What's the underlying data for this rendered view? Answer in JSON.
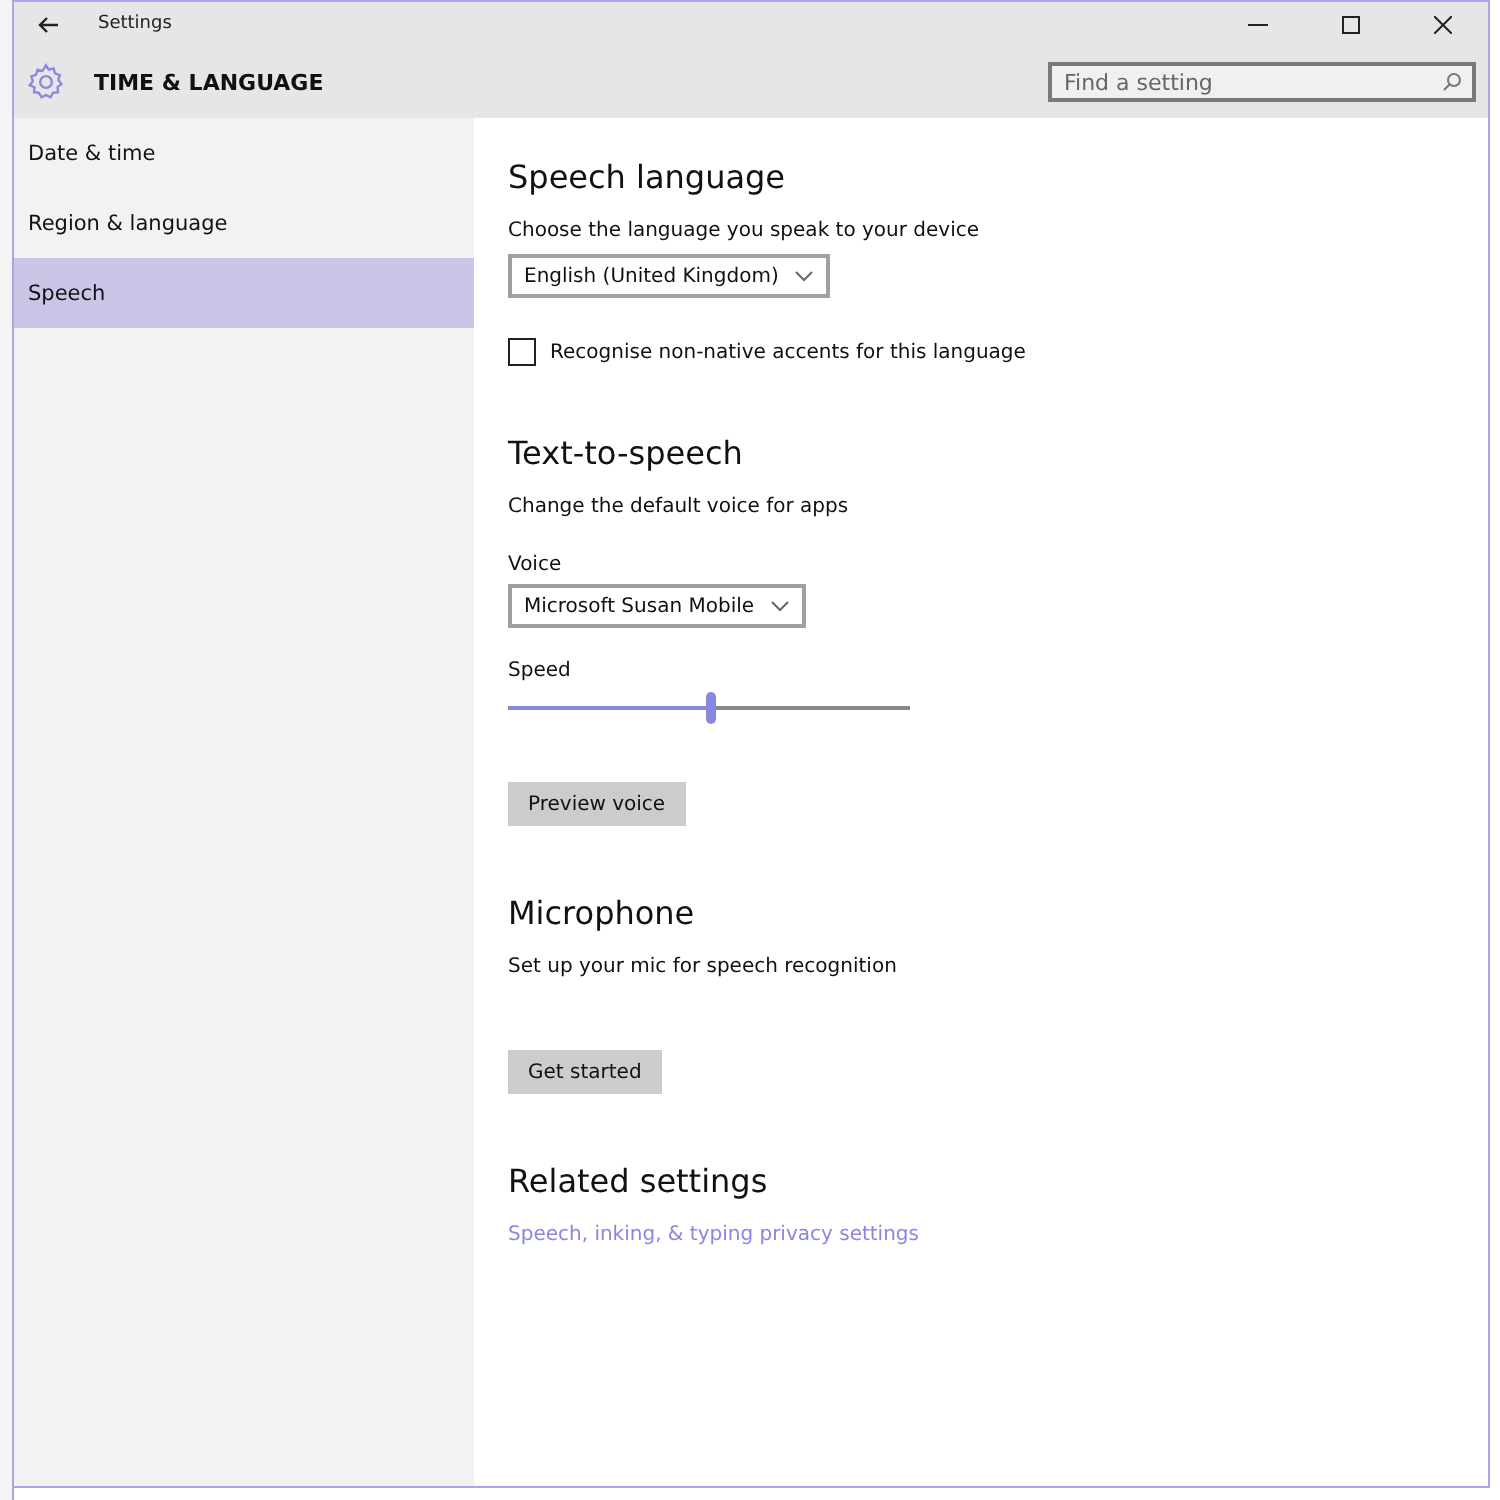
{
  "window": {
    "title": "Settings"
  },
  "header": {
    "title": "TIME & LANGUAGE",
    "search": {
      "placeholder": "Find a setting"
    }
  },
  "sidebar": {
    "items": [
      {
        "label": "Date & time",
        "selected": false
      },
      {
        "label": "Region & language",
        "selected": false
      },
      {
        "label": "Speech",
        "selected": true
      }
    ]
  },
  "speech_language": {
    "heading": "Speech language",
    "description": "Choose the language you speak to your device",
    "language": "English (United Kingdom)",
    "accents": {
      "label": "Recognise non-native accents for this language",
      "checked": false
    }
  },
  "text_to_speech": {
    "heading": "Text-to-speech",
    "description": "Change the default voice for apps",
    "voice_label": "Voice",
    "voice": "Microsoft Susan Mobile",
    "speed_label": "Speed",
    "speed": {
      "level": 0.5
    },
    "preview_button": "Preview voice"
  },
  "microphone": {
    "heading": "Microphone",
    "description": "Set up your mic for speech recognition",
    "button": "Get started"
  },
  "related_settings": {
    "heading": "Related settings",
    "links": [
      "Speech, inking, & typing privacy settings"
    ]
  }
}
